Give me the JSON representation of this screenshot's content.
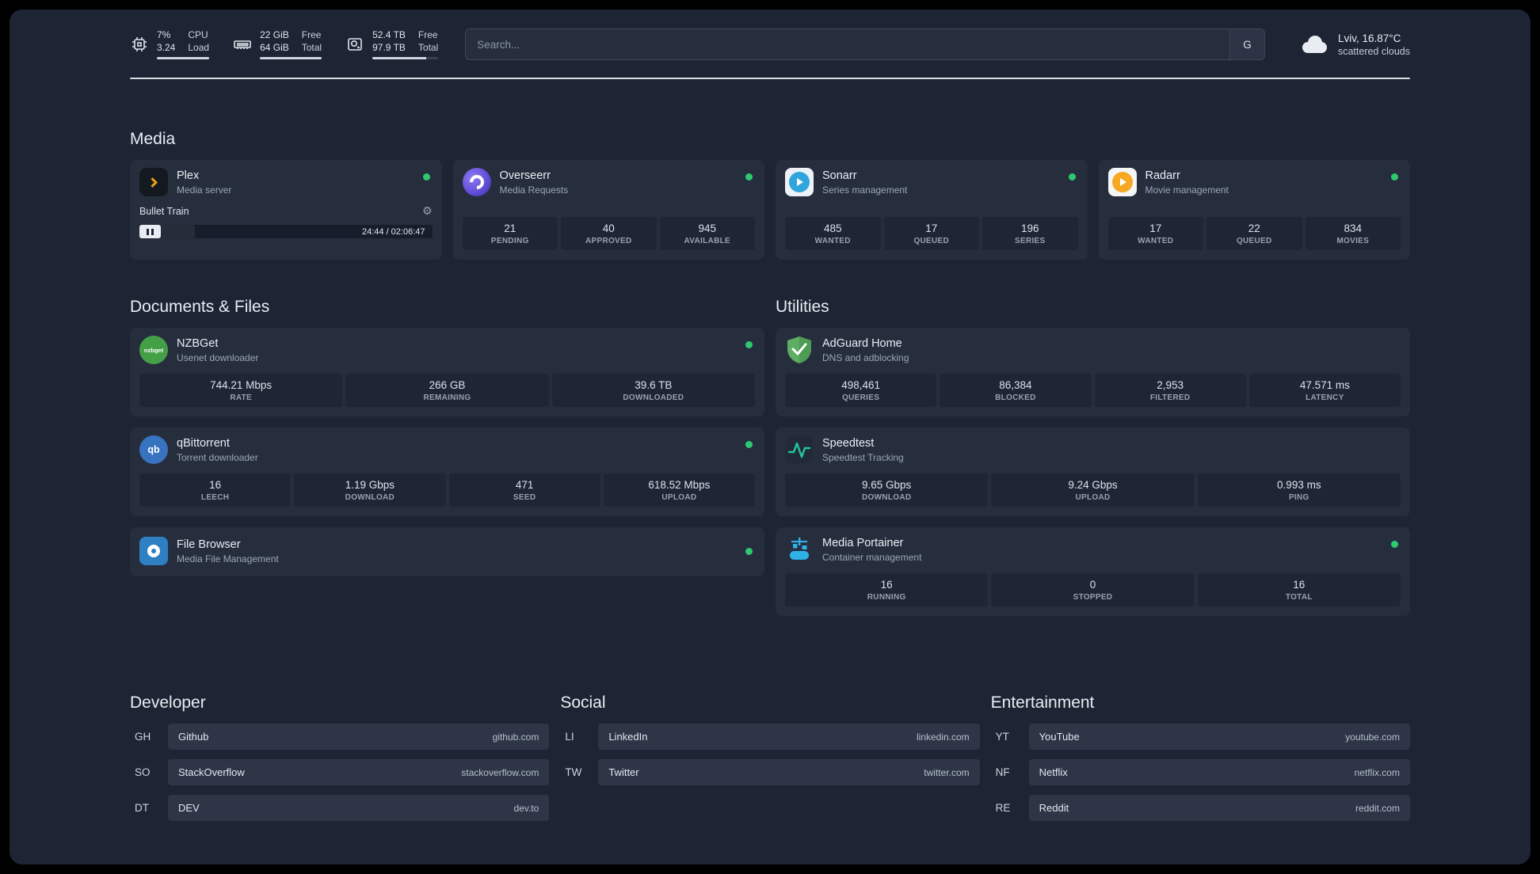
{
  "topbar": {
    "cpu": {
      "value1": "7%",
      "value2": "3.24",
      "label1": "CPU",
      "label2": "Load"
    },
    "memory": {
      "value1": "22 GiB",
      "value2": "64 GiB",
      "label1": "Free",
      "label2": "Total"
    },
    "disk": {
      "value1": "52.4 TB",
      "value2": "97.9 TB",
      "label1": "Free",
      "label2": "Total"
    },
    "search": {
      "placeholder": "Search...",
      "button_label": "G"
    },
    "weather": {
      "location": "Lviv, 16.87°C",
      "condition": "scattered clouds"
    }
  },
  "icons": {
    "gear": "⚙"
  },
  "colors": {
    "background": "#1d2433",
    "card": "#262e3e",
    "stat_box": "#1f2534",
    "status_online": "#2dc96f",
    "accent_plex": "#e5a00d"
  },
  "groups": {
    "media": {
      "title": "Media",
      "services": [
        {
          "name": "Plex",
          "desc": "Media server",
          "online": true,
          "player": {
            "track": "Bullet Train",
            "time": "24:44 / 02:06:47"
          }
        },
        {
          "name": "Overseerr",
          "desc": "Media Requests",
          "online": true,
          "stats": [
            {
              "value": "21",
              "label": "PENDING"
            },
            {
              "value": "40",
              "label": "APPROVED"
            },
            {
              "value": "945",
              "label": "AVAILABLE"
            }
          ]
        },
        {
          "name": "Sonarr",
          "desc": "Series management",
          "online": true,
          "stats": [
            {
              "value": "485",
              "label": "WANTED"
            },
            {
              "value": "17",
              "label": "QUEUED"
            },
            {
              "value": "196",
              "label": "SERIES"
            }
          ]
        },
        {
          "name": "Radarr",
          "desc": "Movie management",
          "online": true,
          "stats": [
            {
              "value": "17",
              "label": "WANTED"
            },
            {
              "value": "22",
              "label": "QUEUED"
            },
            {
              "value": "834",
              "label": "MOVIES"
            }
          ]
        }
      ]
    },
    "documents": {
      "title": "Documents & Files",
      "services": [
        {
          "name": "NZBGet",
          "desc": "Usenet downloader",
          "online": true,
          "icon_text": "nzbget",
          "stats": [
            {
              "value": "744.21 Mbps",
              "label": "RATE"
            },
            {
              "value": "266 GB",
              "label": "REMAINING"
            },
            {
              "value": "39.6 TB",
              "label": "DOWNLOADED"
            }
          ]
        },
        {
          "name": "qBittorrent",
          "desc": "Torrent downloader",
          "online": true,
          "icon_text": "qb",
          "stats": [
            {
              "value": "16",
              "label": "LEECH"
            },
            {
              "value": "1.19 Gbps",
              "label": "DOWNLOAD"
            },
            {
              "value": "471",
              "label": "SEED"
            },
            {
              "value": "618.52 Mbps",
              "label": "UPLOAD"
            }
          ]
        },
        {
          "name": "File Browser",
          "desc": "Media File Management",
          "online": true
        }
      ]
    },
    "utilities": {
      "title": "Utilities",
      "services": [
        {
          "name": "AdGuard Home",
          "desc": "DNS and adblocking",
          "online": false,
          "stats": [
            {
              "value": "498,461",
              "label": "QUERIES"
            },
            {
              "value": "86,384",
              "label": "BLOCKED"
            },
            {
              "value": "2,953",
              "label": "FILTERED"
            },
            {
              "value": "47.571 ms",
              "label": "LATENCY"
            }
          ]
        },
        {
          "name": "Speedtest",
          "desc": "Speedtest Tracking",
          "online": false,
          "stats": [
            {
              "value": "9.65 Gbps",
              "label": "DOWNLOAD"
            },
            {
              "value": "9.24 Gbps",
              "label": "UPLOAD"
            },
            {
              "value": "0.993 ms",
              "label": "PING"
            }
          ]
        },
        {
          "name": "Media Portainer",
          "desc": "Container management",
          "online": true,
          "stats": [
            {
              "value": "16",
              "label": "RUNNING"
            },
            {
              "value": "0",
              "label": "STOPPED"
            },
            {
              "value": "16",
              "label": "TOTAL"
            }
          ]
        }
      ]
    }
  },
  "bookmarks": [
    {
      "title": "Developer",
      "items": [
        {
          "abbr": "GH",
          "name": "Github",
          "url": "github.com"
        },
        {
          "abbr": "SO",
          "name": "StackOverflow",
          "url": "stackoverflow.com"
        },
        {
          "abbr": "DT",
          "name": "DEV",
          "url": "dev.to"
        }
      ]
    },
    {
      "title": "Social",
      "items": [
        {
          "abbr": "LI",
          "name": "LinkedIn",
          "url": "linkedin.com"
        },
        {
          "abbr": "TW",
          "name": "Twitter",
          "url": "twitter.com"
        }
      ]
    },
    {
      "title": "Entertainment",
      "items": [
        {
          "abbr": "YT",
          "name": "YouTube",
          "url": "youtube.com"
        },
        {
          "abbr": "NF",
          "name": "Netflix",
          "url": "netflix.com"
        },
        {
          "abbr": "RE",
          "name": "Reddit",
          "url": "reddit.com"
        }
      ]
    }
  ]
}
